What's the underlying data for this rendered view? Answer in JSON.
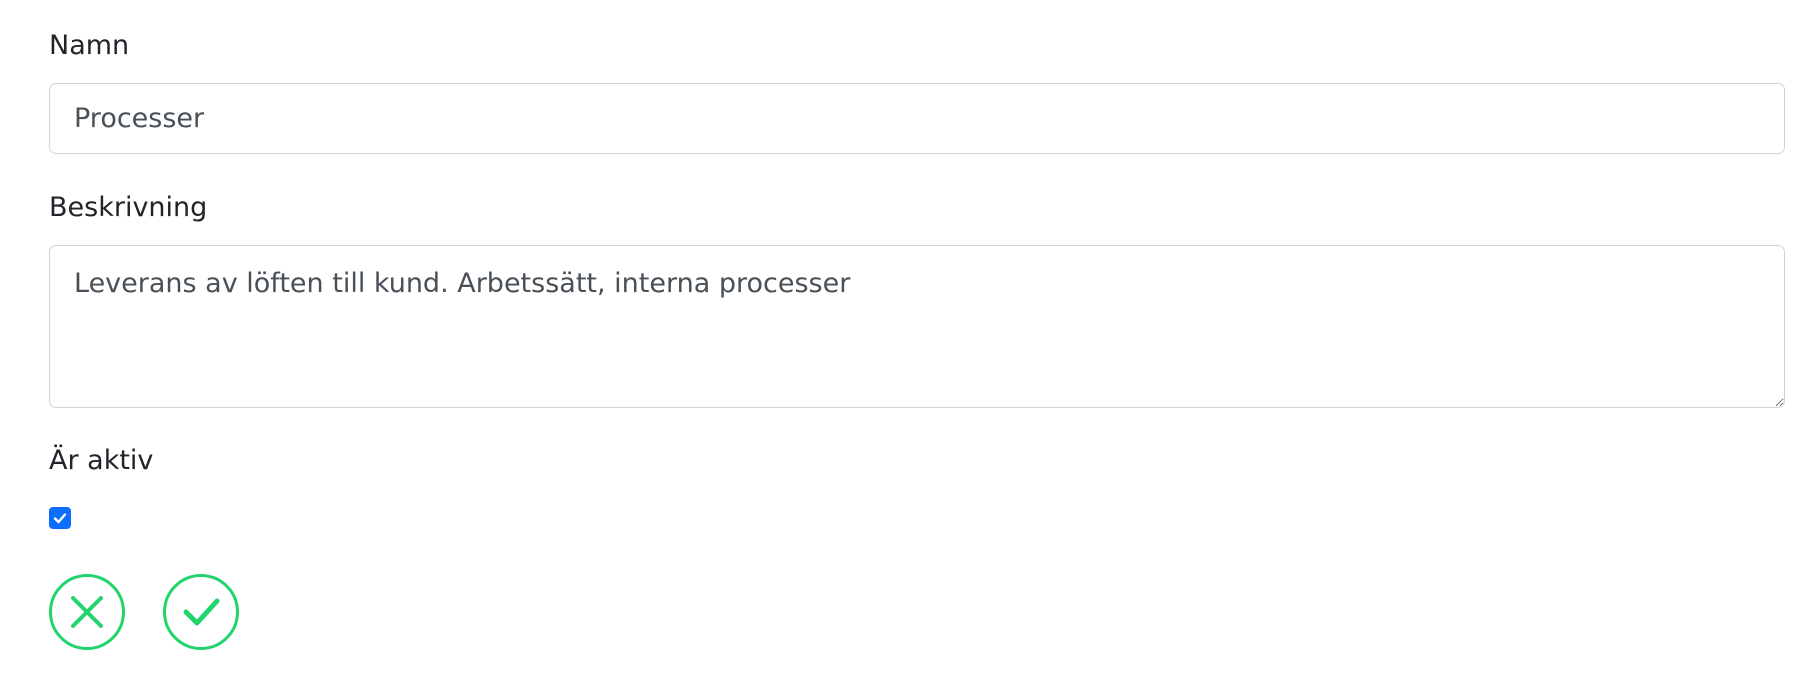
{
  "form": {
    "name": {
      "label": "Namn",
      "value": "Processer"
    },
    "description": {
      "label": "Beskrivning",
      "value": "Leverans av löften till kund. Arbetssätt, interna processer"
    },
    "active": {
      "label": "Är aktiv",
      "checked": true
    }
  },
  "actions": {
    "cancel_icon": "close-icon",
    "confirm_icon": "check-icon",
    "accent_color": "#22d46b"
  },
  "colors": {
    "checkbox": "#0d6efd",
    "border": "#ced4da",
    "text": "#212529",
    "input_text": "#495057"
  }
}
